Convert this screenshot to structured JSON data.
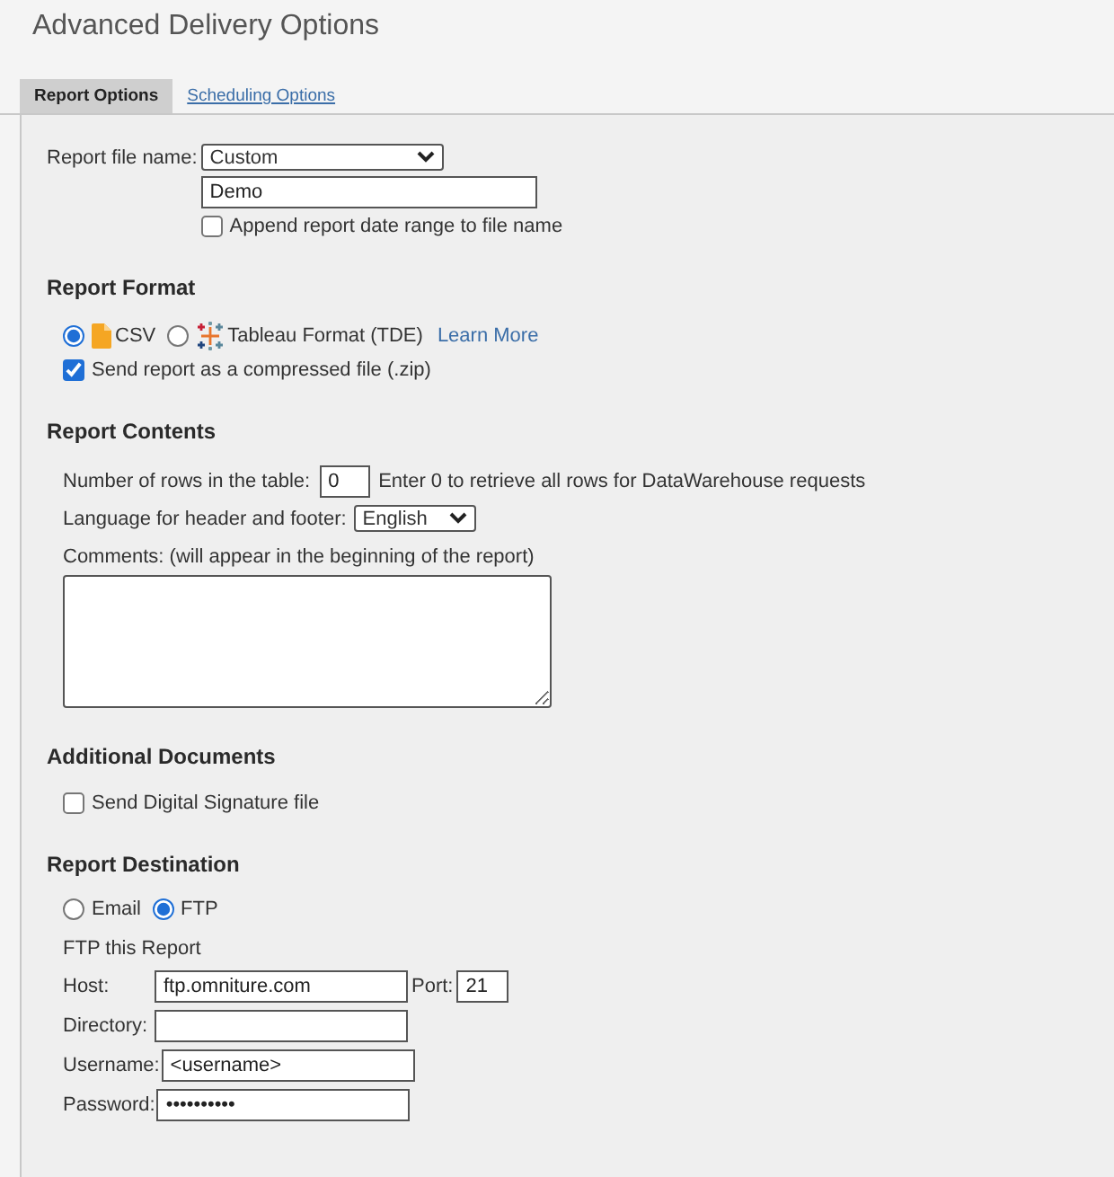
{
  "title": "Advanced Delivery Options",
  "tabs": [
    {
      "label": "Report Options",
      "selected": true
    },
    {
      "label": "Scheduling Options",
      "selected": false
    }
  ],
  "file_name": {
    "label": "Report file name:",
    "select": "Custom",
    "value": "Demo",
    "append": {
      "label": "Append report date range to file name",
      "checked": false
    }
  },
  "report_format": {
    "heading": "Report Format",
    "options": [
      {
        "kind": "csv",
        "label": "CSV",
        "selected": true
      },
      {
        "kind": "tableau",
        "label": "Tableau Format (TDE)",
        "selected": false
      }
    ],
    "learn_more": "Learn More",
    "compress": {
      "label": "Send report as a compressed file (.zip)",
      "checked": true
    }
  },
  "report_contents": {
    "heading": "Report Contents",
    "rows_label": "Number of rows in the table:",
    "rows_value": "0",
    "rows_hint": "Enter 0 to retrieve all rows for DataWarehouse requests",
    "language_label": "Language for header and footer:",
    "language": "English",
    "comments_label": "Comments: (will appear in the beginning of the report)"
  },
  "additional_documents": {
    "heading": "Additional Documents",
    "signature": {
      "label": "Send Digital Signature file",
      "checked": false
    }
  },
  "report_destination": {
    "heading": "Report Destination",
    "options": [
      {
        "label": "Email",
        "selected": false
      },
      {
        "label": "FTP",
        "selected": true
      }
    ],
    "ftp_title": "FTP this Report",
    "port": {
      "label": "Port:",
      "value": "21"
    },
    "fields": [
      {
        "label": "Host:",
        "value": "ftp.omniture.com"
      },
      {
        "label": "Directory:"
      },
      {
        "label": "Username:",
        "value": "<username>"
      },
      {
        "label": "Password:",
        "value": "••••••••••"
      }
    ]
  }
}
